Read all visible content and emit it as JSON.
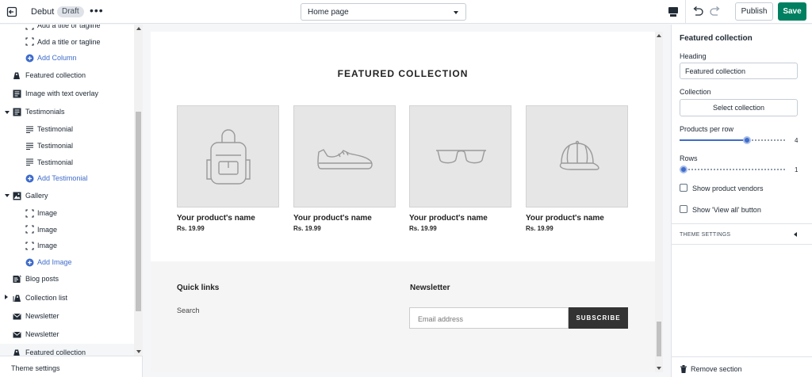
{
  "topbar": {
    "theme_name": "Debut",
    "badge": "Draft",
    "more": "•••",
    "page_select": "Home page",
    "publish_label": "Publish",
    "save_label": "Save"
  },
  "sidebar": {
    "items": [
      {
        "label": "Add a title or tagline",
        "kind": "child",
        "icon": "crop-icon"
      },
      {
        "label": "Add a title or tagline",
        "kind": "child",
        "icon": "crop-icon"
      },
      {
        "label": "Add Column",
        "kind": "add",
        "icon": "plus-circle-icon"
      },
      {
        "label": "Featured collection",
        "kind": "top",
        "icon": "tag-icon"
      },
      {
        "label": "Image with text overlay",
        "kind": "top",
        "icon": "text-block-icon"
      },
      {
        "label": "Testimonials",
        "kind": "top",
        "icon": "text-block-icon",
        "expander": "down"
      },
      {
        "label": "Testimonial",
        "kind": "child",
        "icon": "lines-icon"
      },
      {
        "label": "Testimonial",
        "kind": "child",
        "icon": "lines-icon"
      },
      {
        "label": "Testimonial",
        "kind": "child",
        "icon": "lines-icon"
      },
      {
        "label": "Add Testimonial",
        "kind": "add",
        "icon": "plus-circle-icon"
      },
      {
        "label": "Gallery",
        "kind": "top",
        "icon": "image-icon",
        "expander": "down"
      },
      {
        "label": "Image",
        "kind": "child",
        "icon": "crop-icon"
      },
      {
        "label": "Image",
        "kind": "child",
        "icon": "crop-icon"
      },
      {
        "label": "Image",
        "kind": "child",
        "icon": "crop-icon"
      },
      {
        "label": "Add Image",
        "kind": "add",
        "icon": "plus-circle-icon"
      },
      {
        "label": "Blog posts",
        "kind": "top",
        "icon": "blog-icon"
      },
      {
        "label": "Collection list",
        "kind": "top",
        "icon": "tags-icon",
        "expander": "right"
      },
      {
        "label": "Newsletter",
        "kind": "top",
        "icon": "envelope-icon"
      },
      {
        "label": "Newsletter",
        "kind": "top",
        "icon": "envelope-icon"
      },
      {
        "label": "Featured collection",
        "kind": "top",
        "icon": "tag-icon",
        "active": true
      }
    ],
    "theme_settings": "Theme settings"
  },
  "preview": {
    "section_title": "FEATURED COLLECTION",
    "products": [
      {
        "name": "Your product's name",
        "price": "Rs. 19.99",
        "icon": "backpack-icon"
      },
      {
        "name": "Your product's name",
        "price": "Rs. 19.99",
        "icon": "sneaker-icon"
      },
      {
        "name": "Your product's name",
        "price": "Rs. 19.99",
        "icon": "sunglasses-icon"
      },
      {
        "name": "Your product's name",
        "price": "Rs. 19.99",
        "icon": "cap-icon"
      }
    ],
    "footer": {
      "quick_links_title": "Quick links",
      "quick_link": "Search",
      "newsletter_title": "Newsletter",
      "email_placeholder": "Email address",
      "subscribe_label": "SUBSCRIBE"
    }
  },
  "panel": {
    "title": "Featured collection",
    "heading_label": "Heading",
    "heading_value": "Featured collection",
    "collection_label": "Collection",
    "select_collection": "Select collection",
    "products_per_row_label": "Products per row",
    "products_per_row": {
      "value": "4",
      "fraction": 0.64
    },
    "rows_label": "Rows",
    "rows": {
      "value": "1",
      "fraction": 0.0
    },
    "show_vendors": "Show product vendors",
    "show_view_all": "Show 'View all' button",
    "theme_settings": "THEME SETTINGS",
    "remove_section": "Remove section"
  },
  "colors": {
    "accent": "#3f6ccb",
    "save": "#008060",
    "subscribe": "#333333"
  }
}
